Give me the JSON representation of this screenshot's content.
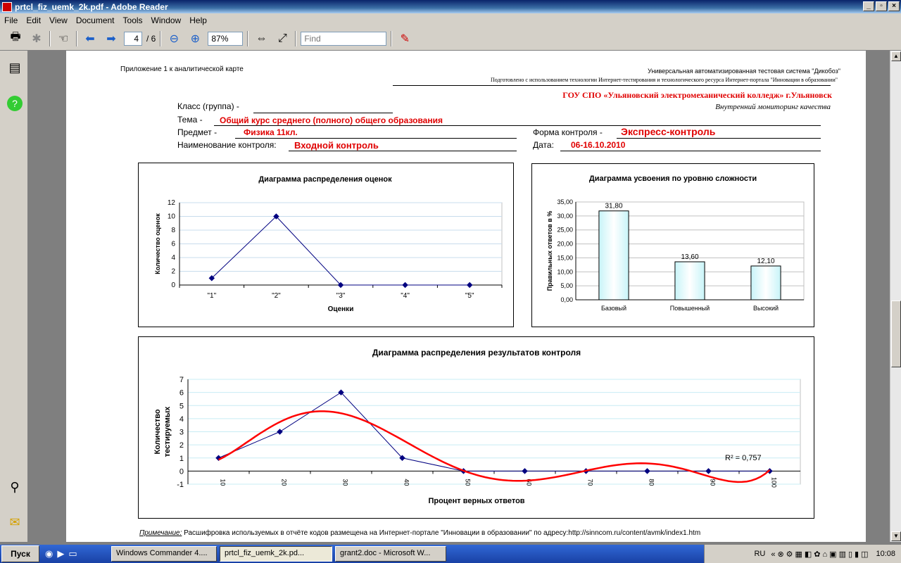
{
  "window": {
    "title": "prtcl_fiz_uemk_2k.pdf - Adobe Reader"
  },
  "menu": [
    "File",
    "Edit",
    "View",
    "Document",
    "Tools",
    "Window",
    "Help"
  ],
  "toolbar": {
    "page_current": "4",
    "page_total": "/ 6",
    "zoom": "87%",
    "find_placeholder": "Find"
  },
  "doc": {
    "appendix": "Приложение 1 к аналитической карте",
    "system": "Универсальная автоматизированная тестовая система \"Дикобоз\"",
    "prepared": "Подготовлено с использованием технологии Интернет-тестирования и технологического ресурса  Интернет-портала \"Инновации в образовании\"",
    "org": "ГОУ СПО «Ульяновский электромеханический колледж» г.Ульяновск",
    "monitoring": "Внутренний мониторинг  качества",
    "class_label": "Класс (группа) -",
    "theme_label": "Тема -",
    "theme_value": "Общий курс среднего (полного) общего образования",
    "subject_label": "Предмет  -",
    "subject_value": "Физика 11кл.",
    "form_label": "Форма контроля -",
    "form_value": "Экспресс-контроль",
    "control_label": "Наименование контроля:",
    "control_value": "Входной  контроль",
    "date_label": "Дата:",
    "date_value": "06-16.10.2010",
    "note_label": "Примечание:",
    "note_text": " Расшифровка используемых в отчёте кодов размещена на Интернет-портале \"Инновации в образовании\" по адресу:http://sinncom.ru/content/avmk/index1.htm"
  },
  "chart_data": [
    {
      "type": "line",
      "title": "Диаграмма распределения оценок",
      "xlabel": "Оценки",
      "ylabel": "Количество оценок",
      "categories": [
        "\"1\"",
        "\"2\"",
        "\"3\"",
        "\"4\"",
        "\"5\""
      ],
      "values": [
        1,
        10,
        0,
        0,
        0
      ],
      "ylim": [
        0,
        12
      ],
      "yticks": [
        "0",
        "2",
        "4",
        "6",
        "8",
        "10",
        "12"
      ],
      "grid": true
    },
    {
      "type": "bar",
      "title": "Диаграмма усвоения по уровню сложности",
      "ylabel": "Правильных ответов в %",
      "categories": [
        "Базовый",
        "Повышенный",
        "Высокий"
      ],
      "values": [
        31.8,
        13.6,
        12.1
      ],
      "data_labels": [
        "31,80",
        "13,60",
        "12,10"
      ],
      "ylim": [
        0,
        35
      ],
      "yticks": [
        "0,00",
        "5,00",
        "10,00",
        "15,00",
        "20,00",
        "25,00",
        "30,00",
        "35,00"
      ],
      "grid": true
    },
    {
      "type": "line",
      "title": "Диаграмма распределения результатов контроля",
      "xlabel": "Процент верных ответов",
      "ylabel": "Количество тестируемых",
      "categories": [
        "10",
        "20",
        "30",
        "40",
        "50",
        "60",
        "70",
        "80",
        "90",
        "100"
      ],
      "values": [
        1,
        3,
        6,
        1,
        0,
        0,
        0,
        0,
        0,
        0
      ],
      "ylim": [
        -1,
        7
      ],
      "yticks": [
        "-1",
        "0",
        "1",
        "2",
        "3",
        "4",
        "5",
        "6",
        "7"
      ],
      "trendline": {
        "r2_label": "R² = 0,757",
        "color": "#ff0000"
      },
      "grid": true
    }
  ],
  "taskbar": {
    "start": "Пуск",
    "tasks": [
      "Windows Commander 4....",
      "prtcl_fiz_uemk_2k.pd...",
      "grant2.doc - Microsoft W..."
    ],
    "lang": "RU",
    "time": "10:08"
  }
}
